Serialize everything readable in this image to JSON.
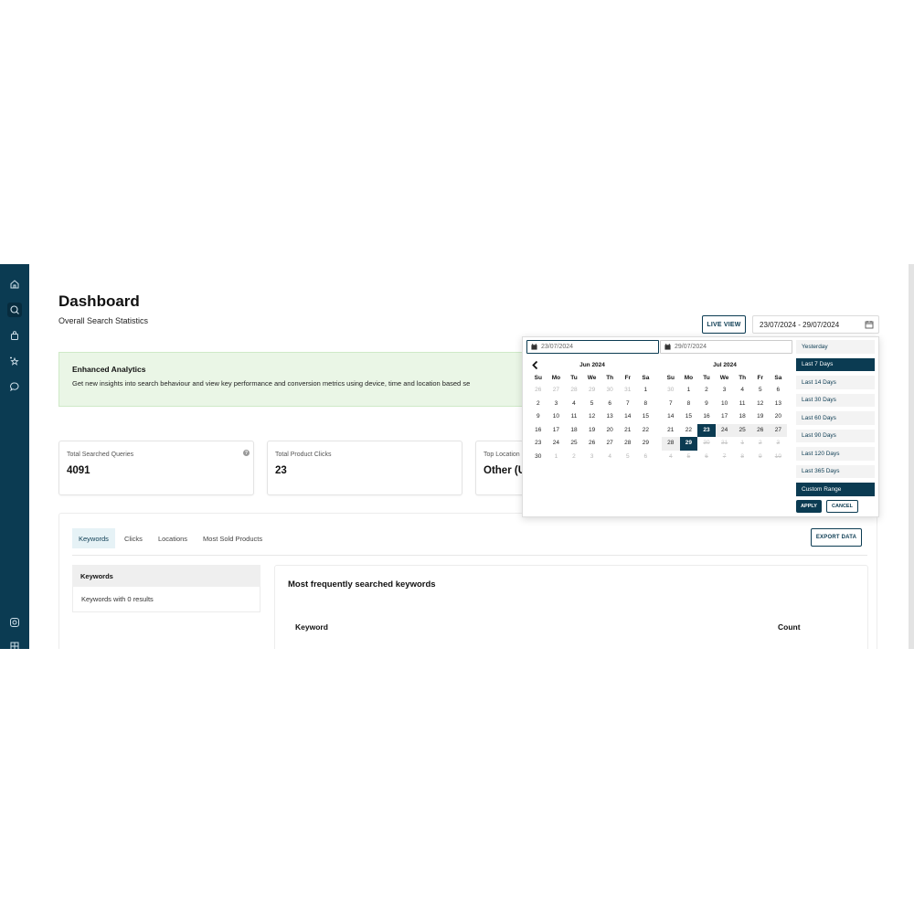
{
  "sidebar": {
    "icons": [
      "home-icon",
      "search-icon",
      "bag-icon",
      "stars-icon",
      "chat-icon",
      "whatsapp-icon",
      "grid-icon"
    ]
  },
  "header": {
    "title": "Dashboard",
    "subtitle": "Overall Search Statistics",
    "live_view": "LIVE VIEW",
    "date_range": "23/07/2024 - 29/07/2024"
  },
  "banner": {
    "title": "Enhanced Analytics",
    "text": "Get new insights into search behaviour and view key performance and conversion metrics using device, time and location based se"
  },
  "stats": [
    {
      "label": "Total Searched Queries",
      "value": "4091"
    },
    {
      "label": "Total Product Clicks",
      "value": "23"
    },
    {
      "label": "Top Location",
      "value": "Other (U"
    }
  ],
  "tabs": [
    "Keywords",
    "Clicks",
    "Locations",
    "Most Sold Products"
  ],
  "export_label": "EXPORT DATA",
  "side_list": {
    "header": "Keywords",
    "items": [
      "Keywords with 0 results"
    ]
  },
  "keywords_card": {
    "title": "Most frequently searched keywords",
    "col_keyword": "Keyword",
    "col_count": "Count"
  },
  "datepicker": {
    "start_value": "23/07/2024",
    "end_value": "29/07/2024",
    "weekdays": [
      "Su",
      "Mo",
      "Tu",
      "We",
      "Th",
      "Fr",
      "Sa"
    ],
    "months": [
      {
        "label": "Jun 2024",
        "days": [
          {
            "d": "26",
            "s": "off"
          },
          {
            "d": "27",
            "s": "off"
          },
          {
            "d": "28",
            "s": "off"
          },
          {
            "d": "29",
            "s": "off"
          },
          {
            "d": "30",
            "s": "off"
          },
          {
            "d": "31",
            "s": "off"
          },
          {
            "d": "1",
            "s": ""
          },
          {
            "d": "2",
            "s": ""
          },
          {
            "d": "3",
            "s": ""
          },
          {
            "d": "4",
            "s": ""
          },
          {
            "d": "5",
            "s": ""
          },
          {
            "d": "6",
            "s": ""
          },
          {
            "d": "7",
            "s": ""
          },
          {
            "d": "8",
            "s": ""
          },
          {
            "d": "9",
            "s": ""
          },
          {
            "d": "10",
            "s": ""
          },
          {
            "d": "11",
            "s": ""
          },
          {
            "d": "12",
            "s": ""
          },
          {
            "d": "13",
            "s": ""
          },
          {
            "d": "14",
            "s": ""
          },
          {
            "d": "15",
            "s": ""
          },
          {
            "d": "16",
            "s": ""
          },
          {
            "d": "17",
            "s": ""
          },
          {
            "d": "18",
            "s": ""
          },
          {
            "d": "19",
            "s": ""
          },
          {
            "d": "20",
            "s": ""
          },
          {
            "d": "21",
            "s": ""
          },
          {
            "d": "22",
            "s": ""
          },
          {
            "d": "23",
            "s": ""
          },
          {
            "d": "24",
            "s": ""
          },
          {
            "d": "25",
            "s": ""
          },
          {
            "d": "26",
            "s": ""
          },
          {
            "d": "27",
            "s": ""
          },
          {
            "d": "28",
            "s": ""
          },
          {
            "d": "29",
            "s": ""
          },
          {
            "d": "30",
            "s": ""
          },
          {
            "d": "1",
            "s": "off"
          },
          {
            "d": "2",
            "s": "off"
          },
          {
            "d": "3",
            "s": "off"
          },
          {
            "d": "4",
            "s": "off"
          },
          {
            "d": "5",
            "s": "off"
          },
          {
            "d": "6",
            "s": "off"
          }
        ]
      },
      {
        "label": "Jul 2024",
        "days": [
          {
            "d": "30",
            "s": "off"
          },
          {
            "d": "1",
            "s": ""
          },
          {
            "d": "2",
            "s": ""
          },
          {
            "d": "3",
            "s": ""
          },
          {
            "d": "4",
            "s": ""
          },
          {
            "d": "5",
            "s": ""
          },
          {
            "d": "6",
            "s": ""
          },
          {
            "d": "7",
            "s": ""
          },
          {
            "d": "8",
            "s": ""
          },
          {
            "d": "9",
            "s": ""
          },
          {
            "d": "10",
            "s": ""
          },
          {
            "d": "11",
            "s": ""
          },
          {
            "d": "12",
            "s": ""
          },
          {
            "d": "13",
            "s": ""
          },
          {
            "d": "14",
            "s": ""
          },
          {
            "d": "15",
            "s": ""
          },
          {
            "d": "16",
            "s": ""
          },
          {
            "d": "17",
            "s": ""
          },
          {
            "d": "18",
            "s": ""
          },
          {
            "d": "19",
            "s": ""
          },
          {
            "d": "20",
            "s": ""
          },
          {
            "d": "21",
            "s": ""
          },
          {
            "d": "22",
            "s": ""
          },
          {
            "d": "23",
            "s": "sel"
          },
          {
            "d": "24",
            "s": "inrange"
          },
          {
            "d": "25",
            "s": "inrange"
          },
          {
            "d": "26",
            "s": "inrange"
          },
          {
            "d": "27",
            "s": "inrange"
          },
          {
            "d": "28",
            "s": "inrange"
          },
          {
            "d": "29",
            "s": "sel"
          },
          {
            "d": "30",
            "s": "dis"
          },
          {
            "d": "31",
            "s": "dis"
          },
          {
            "d": "1",
            "s": "dis"
          },
          {
            "d": "2",
            "s": "dis"
          },
          {
            "d": "3",
            "s": "dis"
          },
          {
            "d": "4",
            "s": "dis"
          },
          {
            "d": "5",
            "s": "dis"
          },
          {
            "d": "6",
            "s": "dis"
          },
          {
            "d": "7",
            "s": "dis"
          },
          {
            "d": "8",
            "s": "dis"
          },
          {
            "d": "9",
            "s": "dis"
          },
          {
            "d": "10",
            "s": "dis"
          }
        ]
      }
    ],
    "ranges": [
      "Yesterday",
      "Last 7 Days",
      "Last 14 Days",
      "Last 30 Days",
      "Last 60 Days",
      "Last 90 Days",
      "Last 120 Days",
      "Last 365 Days",
      "Custom Range"
    ],
    "active_ranges": [
      "Last 7 Days",
      "Custom Range"
    ],
    "apply_label": "APPLY",
    "cancel_label": "CANCEL"
  },
  "colors": {
    "primary": "#0b3b52",
    "banner_bg": "#eaf6e6"
  }
}
